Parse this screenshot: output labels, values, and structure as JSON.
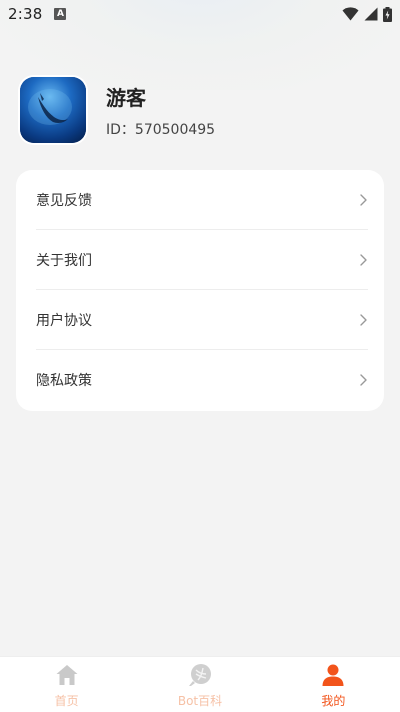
{
  "status_bar": {
    "time": "2:38",
    "indicator": "A"
  },
  "profile": {
    "name": "游客",
    "id_text": "ID：570500495"
  },
  "menu": {
    "items": [
      {
        "label": "意见反馈"
      },
      {
        "label": "关于我们"
      },
      {
        "label": "用户协议"
      },
      {
        "label": "隐私政策"
      }
    ]
  },
  "bottom_nav": {
    "items": [
      {
        "label": "首页",
        "icon": "home-icon",
        "active": false
      },
      {
        "label": "Bot百科",
        "icon": "bot-wiki-icon",
        "active": false
      },
      {
        "label": "我的",
        "icon": "profile-icon",
        "active": true
      }
    ]
  },
  "colors": {
    "accent": "#f2541b",
    "accent_inactive": "#f6c1a6",
    "background": "#f3f3f3",
    "card": "#ffffff"
  }
}
